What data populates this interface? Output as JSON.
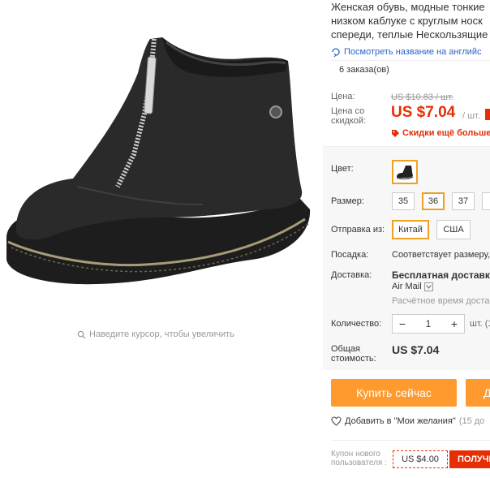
{
  "product": {
    "title_lines": [
      "Женская обувь, модные тонкие",
      "низком каблуке с круглым носк",
      "спереди, теплые Нескользящие"
    ],
    "translate_link": "Посмотреть название на английс",
    "orders": "6 заказа(ов)"
  },
  "gallery": {
    "zoom_hint": "Наведите курсор, чтобы увеличить"
  },
  "price": {
    "price_label": "Цена:",
    "old_price": "US $10.83 / шт.",
    "discount_label": "Цена со скидкой:",
    "new_price": "US $7.04",
    "per_unit": "/ шт.",
    "discount_more": "Скидки ещё больше"
  },
  "options": {
    "color_label": "Цвет:",
    "size_label": "Размер:",
    "sizes": [
      "35",
      "36",
      "37"
    ],
    "selected_size": "36",
    "ships_from_label": "Отправка из:",
    "ships_from": [
      "Китай",
      "США"
    ],
    "fit_label": "Посадка:",
    "fit_value": "Соответствует размеру,",
    "delivery_label": "Доставка:",
    "delivery_title": "Бесплатная доставка в",
    "delivery_carrier": "Air Mail",
    "delivery_time": "Расчётное время доставки",
    "quantity_label": "Количество:",
    "quantity": "1",
    "quantity_minus": "−",
    "quantity_plus": "+",
    "quantity_unit": "шт. (1",
    "total_label": "Общая стоимость:",
    "total_value": "US $7.04"
  },
  "actions": {
    "buy_now": "Купить сейчас",
    "add_to_cart_fragment": "Д",
    "wishlist": "Добавить в \"Мои желания\"",
    "wishlist_count": "(15 до"
  },
  "coupon": {
    "label": "Купон нового пользователя :",
    "value": "US $4.00",
    "get": "ПОЛУЧИ"
  },
  "colors": {
    "accent_orange": "#ff9a2e",
    "selected_border": "#f0a020",
    "price_red": "#e62e04",
    "link_blue": "#2a63c6"
  },
  "icons": {
    "zoom": "search-icon",
    "translate": "translate-icon",
    "discount": "tag-icon",
    "wishlist": "heart-icon",
    "carrier_dropdown": "chevron-down-icon"
  }
}
